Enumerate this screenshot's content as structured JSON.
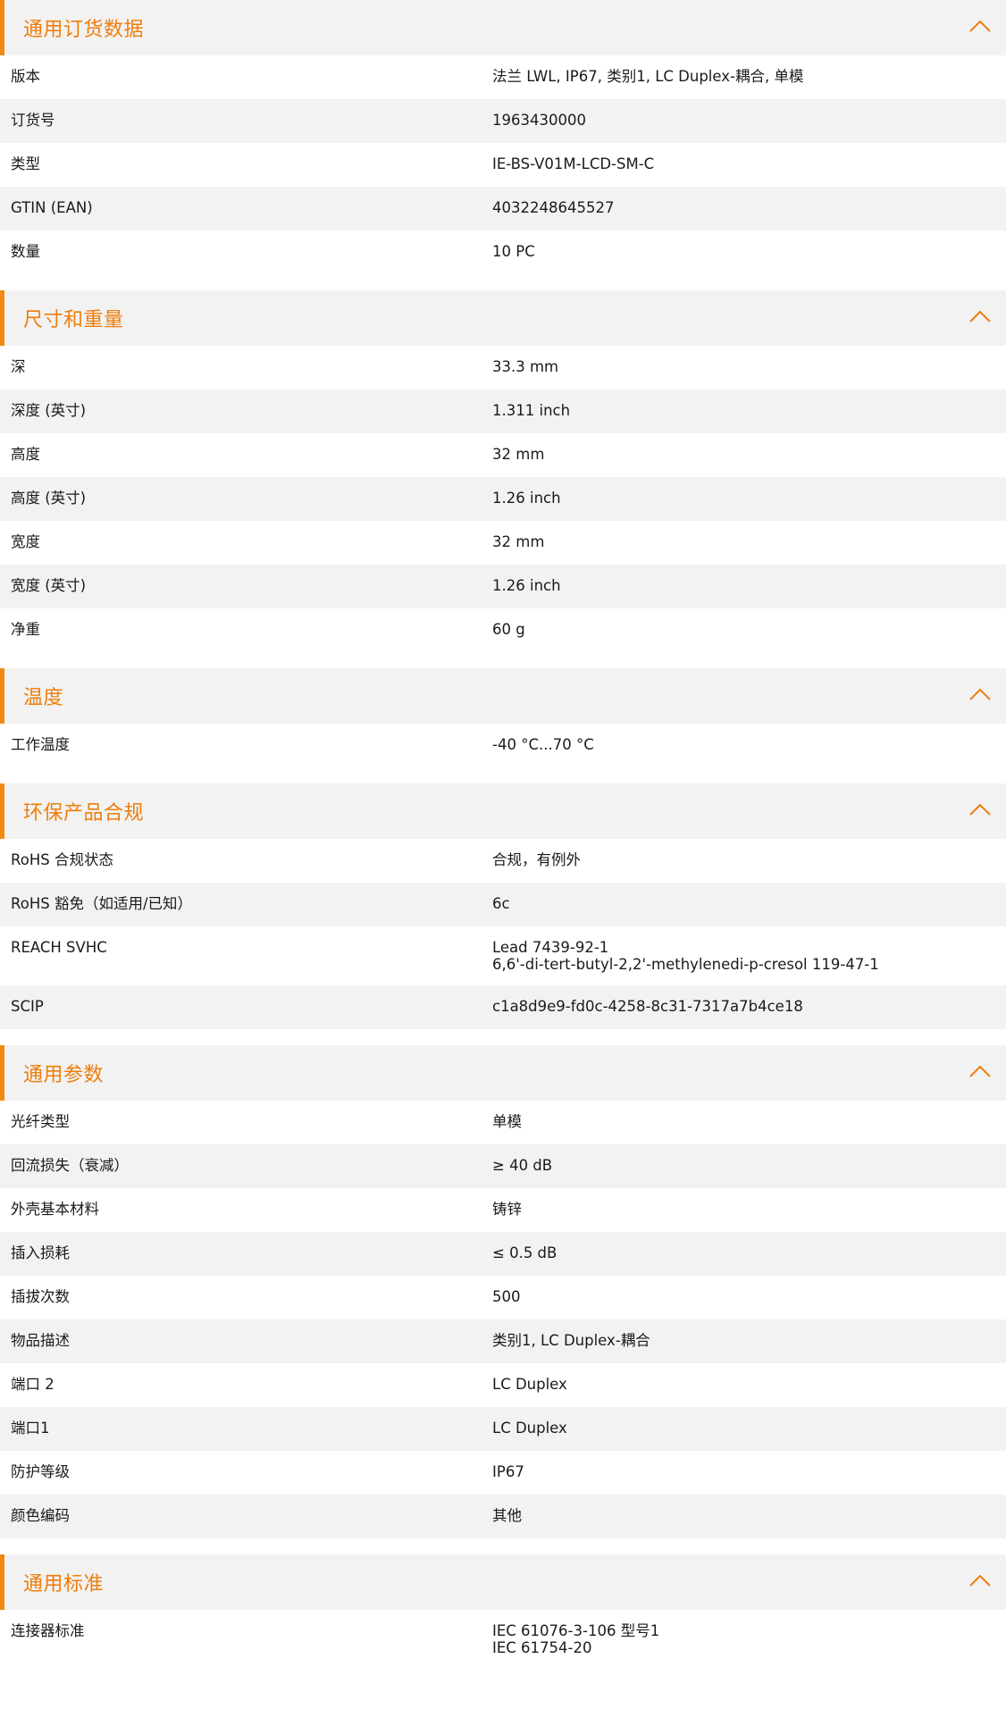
{
  "theme": {
    "accent": "#ef7d0b",
    "row_alt": "#f2f2f2",
    "header_bg": "#f2f2f2"
  },
  "sections": [
    {
      "title": "通用订货数据",
      "icon": "chevron-up-icon",
      "rows": [
        {
          "label": "版本",
          "values": [
            "法兰 LWL, IP67, 类别1, LC Duplex-耦合, 单模"
          ]
        },
        {
          "label": "订货号",
          "values": [
            "1963430000"
          ]
        },
        {
          "label": "类型",
          "values": [
            "IE-BS-V01M-LCD-SM-C"
          ]
        },
        {
          "label": "GTIN (EAN)",
          "values": [
            "4032248645527"
          ]
        },
        {
          "label": "数量",
          "values": [
            "10  PC"
          ]
        }
      ]
    },
    {
      "title": "尺寸和重量",
      "icon": "chevron-up-icon",
      "rows": [
        {
          "label": "深",
          "values": [
            "33.3  mm"
          ]
        },
        {
          "label": "深度 (英寸)",
          "values": [
            "1.311  inch"
          ]
        },
        {
          "label": "高度",
          "values": [
            "32  mm"
          ]
        },
        {
          "label": "高度 (英寸)",
          "values": [
            "1.26  inch"
          ]
        },
        {
          "label": "宽度",
          "values": [
            "32  mm"
          ]
        },
        {
          "label": "宽度 (英寸)",
          "values": [
            "1.26  inch"
          ]
        },
        {
          "label": "净重",
          "values": [
            "60  g"
          ]
        }
      ]
    },
    {
      "title": "温度",
      "icon": "chevron-up-icon",
      "rows": [
        {
          "label": "工作温度",
          "values": [
            "-40 °C...70 °C"
          ]
        }
      ]
    },
    {
      "title": "环保产品合规",
      "icon": "chevron-up-icon",
      "rows": [
        {
          "label": "RoHS 合规状态",
          "values": [
            "合规，有例外"
          ]
        },
        {
          "label": "RoHS 豁免（如适用/已知）",
          "values": [
            "6c"
          ]
        },
        {
          "label": "REACH SVHC",
          "values": [
            "Lead 7439-92-1",
            "6,6'-di-tert-butyl-2,2'-methylenedi-p-cresol 119-47-1"
          ]
        },
        {
          "label": "SCIP",
          "values": [
            "c1a8d9e9-fd0c-4258-8c31-7317a7b4ce18"
          ]
        }
      ]
    },
    {
      "title": "通用参数",
      "icon": "chevron-up-icon",
      "rows": [
        {
          "label": "光纤类型",
          "values": [
            "单模"
          ]
        },
        {
          "label": "回流损失（衰减）",
          "values": [
            "≥ 40 dB"
          ]
        },
        {
          "label": "外壳基本材料",
          "values": [
            "铸锌"
          ]
        },
        {
          "label": "插入损耗",
          "values": [
            "≤ 0.5 dB"
          ]
        },
        {
          "label": "插拔次数",
          "values": [
            "500"
          ]
        },
        {
          "label": "物品描述",
          "values": [
            "类别1, LC Duplex-耦合"
          ]
        },
        {
          "label": "端口 2",
          "values": [
            "LC Duplex"
          ]
        },
        {
          "label": "端口1",
          "values": [
            "LC Duplex"
          ]
        },
        {
          "label": "防护等级",
          "values": [
            "IP67"
          ]
        },
        {
          "label": "颜色编码",
          "values": [
            "其他"
          ]
        }
      ]
    },
    {
      "title": "通用标准",
      "icon": "chevron-up-icon",
      "rows": [
        {
          "label": "连接器标准",
          "values": [
            "IEC 61076-3-106 型号1",
            "IEC 61754-20"
          ]
        }
      ]
    }
  ]
}
